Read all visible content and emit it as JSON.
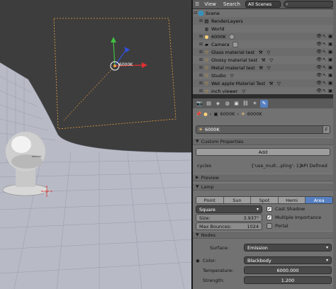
{
  "viewport": {
    "lamp_label": "6000K"
  },
  "outliner_header": {
    "view_menu": "View",
    "search_menu": "Search",
    "scenes_select": "All Scenes",
    "search_icon": "search-icon"
  },
  "outliner": {
    "rows": [
      {
        "label": "Scene"
      },
      {
        "label": "RenderLayers"
      },
      {
        "label": "World"
      },
      {
        "label": "6000K"
      },
      {
        "label": "Camera"
      },
      {
        "label": "Glass material test"
      },
      {
        "label": "Glossy material test"
      },
      {
        "label": "Metal material test"
      },
      {
        "label": "Studio"
      },
      {
        "label": "Wet apple Material Test"
      },
      {
        "label": "inch viewer"
      }
    ]
  },
  "properties": {
    "breadcrumb_object": "6000K",
    "breadcrumb_data": "6000K",
    "name_value": "6000K",
    "fake_user_label": "F",
    "custom_props_header": "Custom Properties",
    "add_button": "Add",
    "cycles_label": "cycles",
    "cycles_value": "{'use_mult...pling': 1}",
    "api_defined": "API Defined",
    "preview_header": "Preview",
    "lamp_header": "Lamp",
    "lamp_types": [
      "Point",
      "Sun",
      "Spot",
      "Hemi",
      "Area"
    ],
    "lamp_type_selected": "Area",
    "shape_select": "Square",
    "size_label": "Size:",
    "size_value": "3.937\"",
    "max_bounces_label": "Max Bounces:",
    "max_bounces_value": "1024",
    "cast_shadow": "Cast Shadow",
    "multiple_importance": "Multiple Importance",
    "portal": "Portal",
    "nodes_header": "Nodes",
    "surface_label": "Surface:",
    "surface_value": "Emission",
    "color_label": "Color:",
    "color_value": "Blackbody",
    "temperature_label": "Temperature:",
    "temperature_value": "6000.000",
    "strength_label": "Strength:",
    "strength_value": "1.200"
  }
}
